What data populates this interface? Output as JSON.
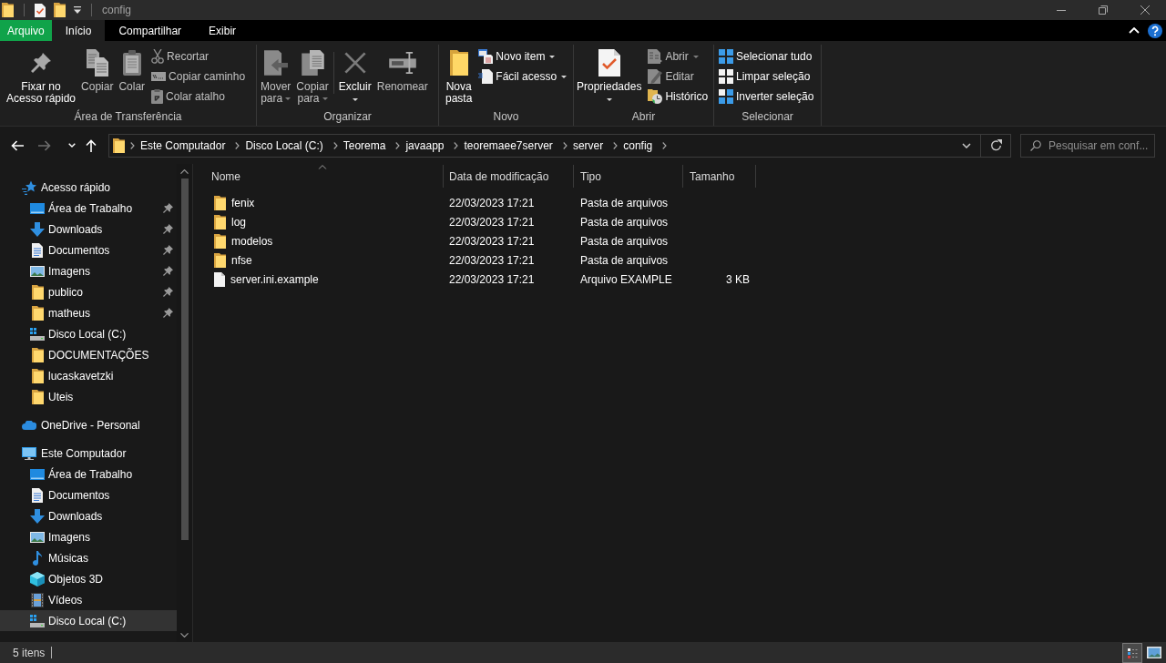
{
  "window": {
    "title": "config"
  },
  "ribbon_tabs": [
    {
      "label": "Arquivo",
      "kind": "backstage",
      "selected": false
    },
    {
      "label": "Início",
      "kind": "tab",
      "selected": true
    },
    {
      "label": "Compartilhar",
      "kind": "tab",
      "selected": false
    },
    {
      "label": "Exibir",
      "kind": "tab",
      "selected": false
    }
  ],
  "ribbon": {
    "groups": [
      {
        "label": "Área de Transferência",
        "items": [
          {
            "kind": "large",
            "label": "Fixar no\nAcesso rápido",
            "menu": false,
            "disabled": false
          },
          {
            "kind": "large",
            "label": "Copiar",
            "menu": false,
            "disabled": true
          },
          {
            "kind": "large",
            "label": "Colar",
            "menu": false,
            "disabled": true
          },
          {
            "kind": "small",
            "label": "Recortar",
            "menu": false,
            "disabled": true
          },
          {
            "kind": "small",
            "label": "Copiar caminho",
            "menu": false,
            "disabled": true
          },
          {
            "kind": "small",
            "label": "Colar atalho",
            "menu": false,
            "disabled": true
          }
        ]
      },
      {
        "label": "Organizar",
        "items": [
          {
            "kind": "large",
            "label": "Mover\npara",
            "menu": true,
            "disabled": true
          },
          {
            "kind": "large",
            "label": "Copiar\npara",
            "menu": true,
            "disabled": true
          },
          {
            "kind": "separator"
          },
          {
            "kind": "large",
            "label": "Excluir",
            "menu": true,
            "disabled": false
          },
          {
            "kind": "large",
            "label": "Renomear",
            "menu": false,
            "disabled": true
          }
        ]
      },
      {
        "label": "Novo",
        "items": [
          {
            "kind": "large",
            "label": "Nova\npasta",
            "menu": false,
            "disabled": false
          },
          {
            "kind": "small",
            "label": "Novo item",
            "menu": true,
            "disabled": false
          },
          {
            "kind": "small",
            "label": "Fácil acesso",
            "menu": true,
            "disabled": false
          }
        ]
      },
      {
        "label": "Abrir",
        "items": [
          {
            "kind": "large",
            "label": "Propriedades",
            "menu": true,
            "disabled": false
          },
          {
            "kind": "small",
            "label": "Abrir",
            "menu": true,
            "disabled": true
          },
          {
            "kind": "small",
            "label": "Editar",
            "menu": false,
            "disabled": true
          },
          {
            "kind": "small",
            "label": "Histórico",
            "menu": false,
            "disabled": false
          }
        ]
      },
      {
        "label": "Selecionar",
        "items": [
          {
            "kind": "small",
            "label": "Selecionar tudo",
            "menu": false,
            "disabled": false
          },
          {
            "kind": "small",
            "label": "Limpar seleção",
            "menu": false,
            "disabled": false
          },
          {
            "kind": "small",
            "label": "Inverter seleção",
            "menu": false,
            "disabled": false
          }
        ]
      }
    ]
  },
  "navigation": {
    "back": {
      "disabled": false
    },
    "forward": {
      "disabled": true
    }
  },
  "address_bar": {
    "path": [
      "Este Computador",
      "Disco Local (C:)",
      "Teorema",
      "javaapp",
      "teoremaee7server",
      "server",
      "config"
    ]
  },
  "search_box": {
    "placeholder": "Pesquisar em conf..."
  },
  "navigation_pane": {
    "sections": [
      {
        "label": "Acesso rápido",
        "children": [
          {
            "label": "Área de Trabalho",
            "pinned": true
          },
          {
            "label": "Downloads",
            "pinned": true
          },
          {
            "label": "Documentos",
            "pinned": true
          },
          {
            "label": "Imagens",
            "pinned": true
          },
          {
            "label": "publico",
            "pinned": true
          },
          {
            "label": "matheus",
            "pinned": true
          },
          {
            "label": "Disco Local (C:)",
            "pinned": false
          },
          {
            "label": "DOCUMENTAÇÕES",
            "pinned": false
          },
          {
            "label": "lucaskavetzki",
            "pinned": false
          },
          {
            "label": "Uteis",
            "pinned": false
          }
        ]
      },
      {
        "label": "OneDrive - Personal"
      },
      {
        "label": "Este Computador",
        "children": [
          {
            "label": "Área de Trabalho",
            "highlighted": false
          },
          {
            "label": "Documentos",
            "highlighted": false
          },
          {
            "label": "Downloads",
            "highlighted": false
          },
          {
            "label": "Imagens",
            "highlighted": false
          },
          {
            "label": "Músicas",
            "highlighted": false
          },
          {
            "label": "Objetos 3D",
            "highlighted": false
          },
          {
            "label": "Vídeos",
            "highlighted": false
          },
          {
            "label": "Disco Local (C:)",
            "highlighted": true
          }
        ]
      }
    ]
  },
  "file_list": {
    "columns": [
      {
        "label": "Nome",
        "sorted": true
      },
      {
        "label": "Data de modificação",
        "sorted": false
      },
      {
        "label": "Tipo",
        "sorted": false
      },
      {
        "label": "Tamanho",
        "sorted": false
      }
    ],
    "rows": [
      {
        "kind": "folder",
        "name": "fenix",
        "modified": "22/03/2023 17:21",
        "type": "Pasta de arquivos"
      },
      {
        "kind": "folder",
        "name": "log",
        "modified": "22/03/2023 17:21",
        "type": "Pasta de arquivos"
      },
      {
        "kind": "folder",
        "name": "modelos",
        "modified": "22/03/2023 17:21",
        "type": "Pasta de arquivos"
      },
      {
        "kind": "folder",
        "name": "nfse",
        "modified": "22/03/2023 17:21",
        "type": "Pasta de arquivos"
      },
      {
        "kind": "file",
        "name": "server.ini.example",
        "modified": "22/03/2023 17:21",
        "type": "Arquivo EXAMPLE",
        "size": "3 KB"
      }
    ]
  },
  "status_bar": {
    "item_count": "5 itens",
    "view_buttons": [
      {
        "selected": true
      },
      {
        "selected": false
      }
    ]
  }
}
